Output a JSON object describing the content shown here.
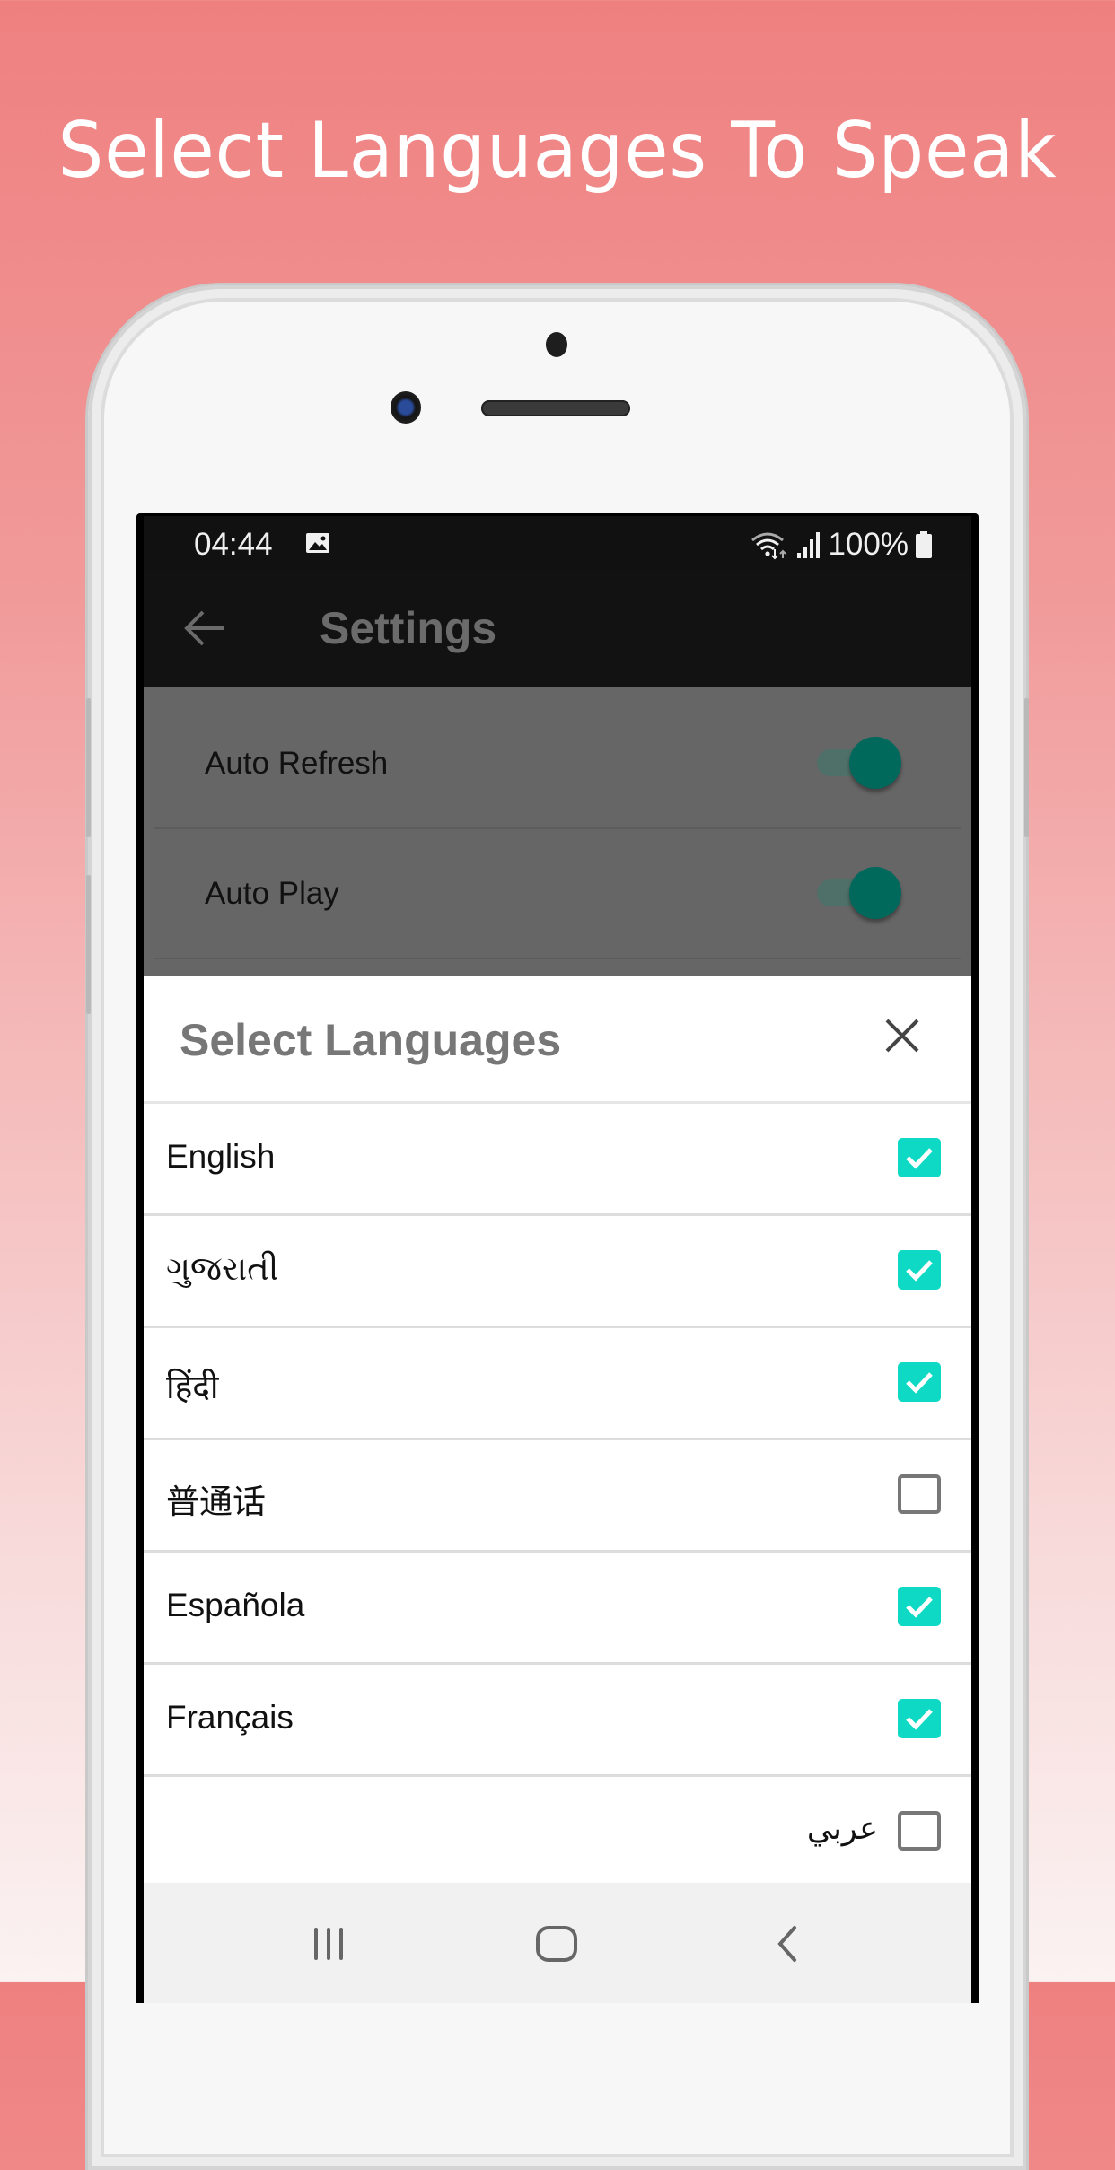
{
  "promo": {
    "headline": "Select Languages To Speak",
    "background_top_color": "#ef8080",
    "background_bottom_color": "#fbf2f2"
  },
  "status_bar": {
    "time": "04:44",
    "battery_text": "100%",
    "icons": [
      "gallery-icon",
      "wifi-icon",
      "signal-icon",
      "battery-icon"
    ]
  },
  "app_bar": {
    "title": "Settings",
    "back_icon": "back-arrow-icon"
  },
  "settings": {
    "items": [
      {
        "label": "Auto Refresh",
        "enabled": true
      },
      {
        "label": "Auto Play",
        "enabled": true
      }
    ],
    "toggle_color": "#00695c"
  },
  "language_sheet": {
    "title": "Select Languages",
    "close_icon": "close-icon",
    "checkbox_color": "#0dd9c4",
    "languages": [
      {
        "label": "English",
        "checked": true
      },
      {
        "label": "ગુજરાતી",
        "checked": true
      },
      {
        "label": "हिंदी",
        "checked": true
      },
      {
        "label": "普通话",
        "checked": false
      },
      {
        "label": "Española",
        "checked": true
      },
      {
        "label": "Français",
        "checked": true
      },
      {
        "label": "عربي",
        "checked": false,
        "rtl": true
      }
    ]
  },
  "nav_bar": {
    "buttons": [
      "recents-icon",
      "home-icon",
      "back-icon"
    ]
  }
}
